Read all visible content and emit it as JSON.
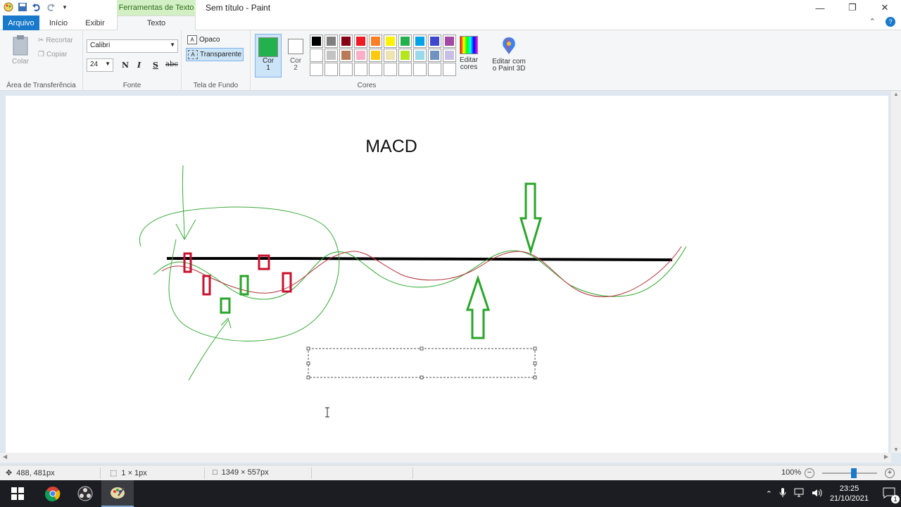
{
  "window": {
    "context_tab": "Ferramentas de Texto",
    "title": "Sem título - Paint"
  },
  "tabs": {
    "file": "Arquivo",
    "home": "Início",
    "view": "Exibir",
    "text": "Texto"
  },
  "ribbon": {
    "clipboard": {
      "paste": "Colar",
      "cut": "Recortar",
      "copy": "Copiar",
      "label": "Área de Transferência"
    },
    "font": {
      "family": "Calibri",
      "size": "24",
      "bold": "N",
      "italic": "I",
      "underline": "S",
      "strike": "abc",
      "label": "Fonte"
    },
    "background": {
      "opaque": "Opaco",
      "transparent": "Transparente",
      "label": "Tela de Fundo"
    },
    "colors": {
      "color1_line1": "Cor",
      "color1_line2": "1",
      "color2_line1": "Cor",
      "color2_line2": "2",
      "color1_value": "#22b14c",
      "color2_value": "#ffffff",
      "palette_row1": [
        "#000000",
        "#7f7f7f",
        "#880015",
        "#ed1c24",
        "#ff7f27",
        "#fff200",
        "#22b14c",
        "#00a2e8",
        "#3f48cc",
        "#a349a4"
      ],
      "palette_row2": [
        "#ffffff",
        "#c3c3c3",
        "#b97a57",
        "#ffaec9",
        "#ffc90e",
        "#efe4b0",
        "#b5e61d",
        "#99d9ea",
        "#7092be",
        "#c8bfe7"
      ],
      "edit_line1": "Editar",
      "edit_line2": "cores",
      "paint3d_line1": "Editar com",
      "paint3d_line2": "o Paint 3D",
      "label": "Cores"
    }
  },
  "canvas": {
    "drawing_text": "MACD"
  },
  "status": {
    "cursor_pos": "488, 481px",
    "selection_size": "1 × 1px",
    "image_size": "1349 × 557px",
    "zoom": "100%",
    "zoom_level_fraction": 0.58
  },
  "taskbar": {
    "time": "23:25",
    "date": "21/10/2021",
    "notifications": "1"
  }
}
